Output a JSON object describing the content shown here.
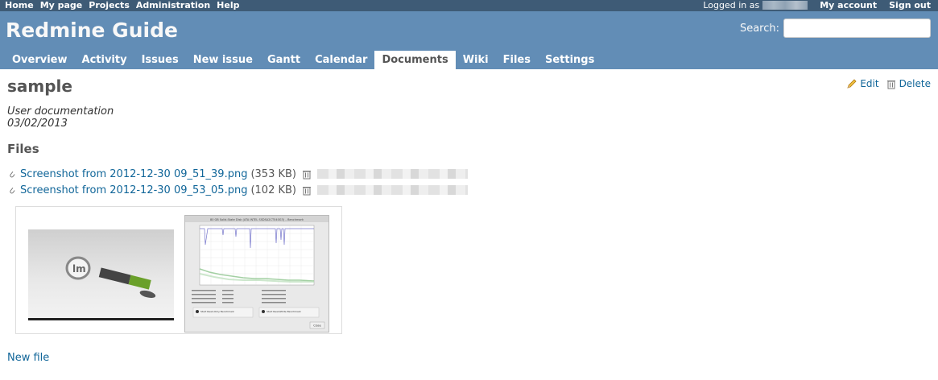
{
  "top_menu": {
    "items": [
      "Home",
      "My page",
      "Projects",
      "Administration",
      "Help"
    ],
    "logged_in_label": "Logged in as",
    "my_account": "My account",
    "sign_out": "Sign out"
  },
  "header": {
    "title": "Redmine Guide",
    "search_label": "Search:",
    "search_value": ""
  },
  "main_menu": {
    "tabs": [
      "Overview",
      "Activity",
      "Issues",
      "New issue",
      "Gantt",
      "Calendar",
      "Documents",
      "Wiki",
      "Files",
      "Settings"
    ],
    "selected": "Documents"
  },
  "document": {
    "title": "sample",
    "category": "User documentation",
    "date": "03/02/2013",
    "edit_label": "Edit",
    "delete_label": "Delete"
  },
  "files": {
    "heading": "Files",
    "attachments": [
      {
        "name": "Screenshot from 2012-12-30 09_51_39.png",
        "size": "(353 KB)"
      },
      {
        "name": "Screenshot from 2012-12-30 09_53_05.png",
        "size": "(102 KB)"
      }
    ],
    "thumbnail_texts": {
      "benchmark_title": "80 GB Solid-State Disk (ATA INTEL SSDSA2CT040G3) – Benchmark",
      "close_button": "Close",
      "read_only_benchmark": "Start Read-Only Benchmark",
      "read_write_benchmark": "Start Read/Write Benchmark"
    },
    "new_file_label": "New file"
  },
  "colors": {
    "top_menu_bg": "#3e5b76",
    "header_bg": "#628db6",
    "link": "#169"
  }
}
